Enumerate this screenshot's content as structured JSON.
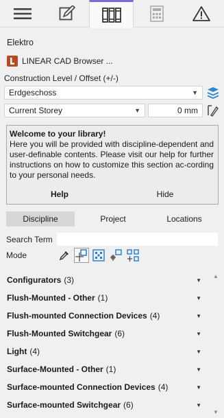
{
  "tabs": [
    {
      "name": "menu",
      "icon": "hamburger-menu-icon"
    },
    {
      "name": "edit",
      "icon": "pencil-edit-icon"
    },
    {
      "name": "library",
      "icon": "library-books-icon",
      "active": true
    },
    {
      "name": "calculator",
      "icon": "calculator-icon"
    },
    {
      "name": "warning",
      "icon": "warning-triangle-icon"
    }
  ],
  "section_title": "Elektro",
  "browser": {
    "name": "LINEAR CAD Browser ..."
  },
  "construction": {
    "label": "Construction Level / Offset (+/-)",
    "level_value": "Erdgeschoss",
    "storey_value": "Current Storey",
    "offset_value": "0 mm"
  },
  "infobox": {
    "title": "Welcome to your library!",
    "text": "Here you will be provided with discipline-dependent and user-definable contents. Please visit our help for further instructions on how to customize this section ac-cording to your personal needs.",
    "help_label": "Help",
    "hide_label": "Hide"
  },
  "segments": [
    {
      "label": "Discipline",
      "active": true
    },
    {
      "label": "Project",
      "active": false
    },
    {
      "label": "Locations",
      "active": false
    }
  ],
  "search": {
    "label": "Search Term",
    "value": ""
  },
  "mode": {
    "label": "Mode"
  },
  "categories": [
    {
      "name": "Configurators",
      "count": "(3)"
    },
    {
      "name": "Flush-Mounted - Other",
      "count": "(1)"
    },
    {
      "name": "Flush-mounted Connection Devices",
      "count": "(4)"
    },
    {
      "name": "Flush-Mounted Switchgear",
      "count": "(6)"
    },
    {
      "name": "Light",
      "count": "(4)"
    },
    {
      "name": "Surface-Mounted - Other",
      "count": "(1)"
    },
    {
      "name": "Surface-mounted Connection Devices",
      "count": "(4)"
    },
    {
      "name": "Surface-mounted Switchgear",
      "count": "(6)"
    }
  ],
  "colors": {
    "accent": "#7b6cd9",
    "link_blue": "#1e7bd6"
  }
}
